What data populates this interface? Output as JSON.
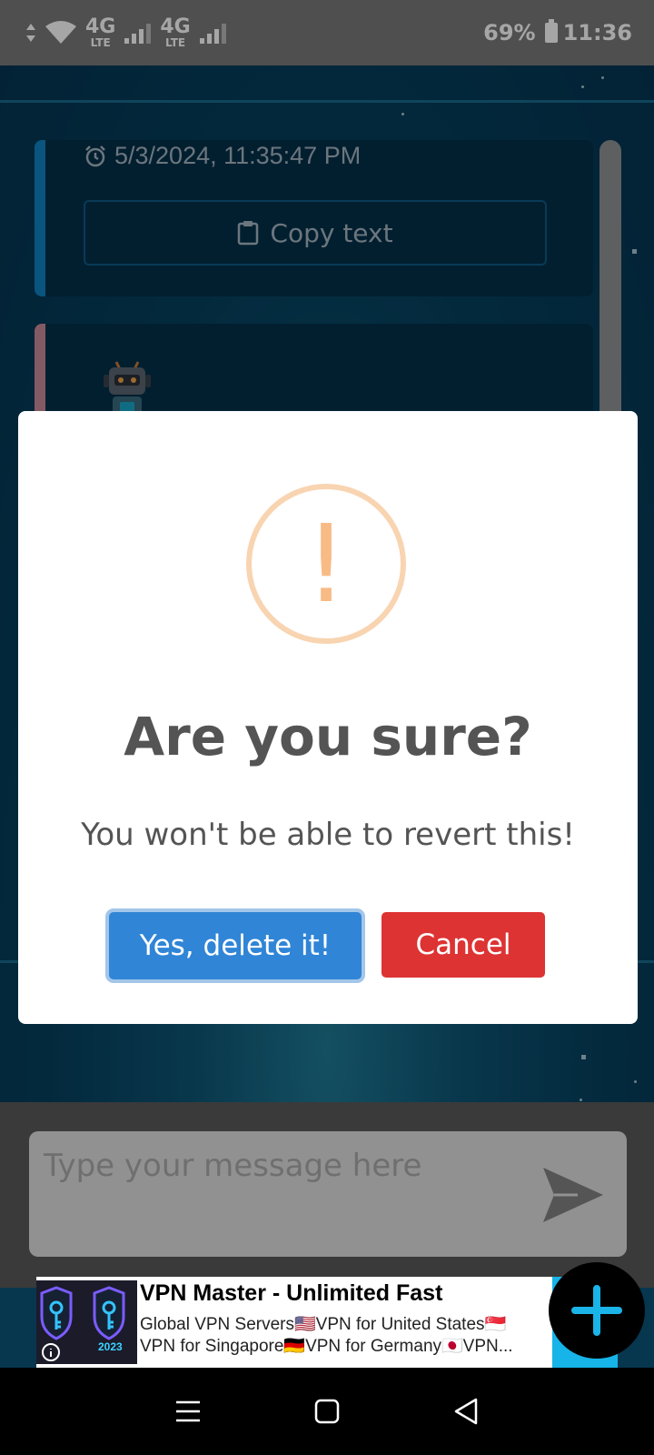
{
  "status_bar": {
    "network_1": "4G",
    "network_1_sub": "LTE",
    "network_2": "4G",
    "network_2_sub": "LTE",
    "battery": "69%",
    "time": "11:36"
  },
  "chat": {
    "messages": [
      {
        "timestamp": "5/3/2024, 11:35:47 PM",
        "copy_label": "Copy text",
        "accent_color": "#0e83c4"
      },
      {
        "avatar_icon": "robot-avatar-icon",
        "accent_color": "#c98a99"
      }
    ]
  },
  "dialog": {
    "icon": "warning-icon",
    "icon_glyph": "!",
    "title": "Are you sure?",
    "text": "You won't be able to revert this!",
    "confirm_label": "Yes, delete it!",
    "cancel_label": "Cancel",
    "confirm_color": "#3085d6",
    "cancel_color": "#dd3333"
  },
  "composer": {
    "placeholder": "Type your message here",
    "send_icon": "send-icon"
  },
  "ad": {
    "image_label": "2023",
    "title": "VPN Master - Unlimited Fast",
    "line1": "Global VPN Servers🇺🇸VPN for United States🇸🇬",
    "line2": "VPN for Singapore🇩🇪VPN for Germany🇯🇵VPN..."
  },
  "fab": {
    "icon": "plus-icon",
    "color": "#1ab4e8"
  },
  "nav": {
    "recents_icon": "menu-icon",
    "home_icon": "home-square-icon",
    "back_icon": "back-triangle-icon"
  }
}
